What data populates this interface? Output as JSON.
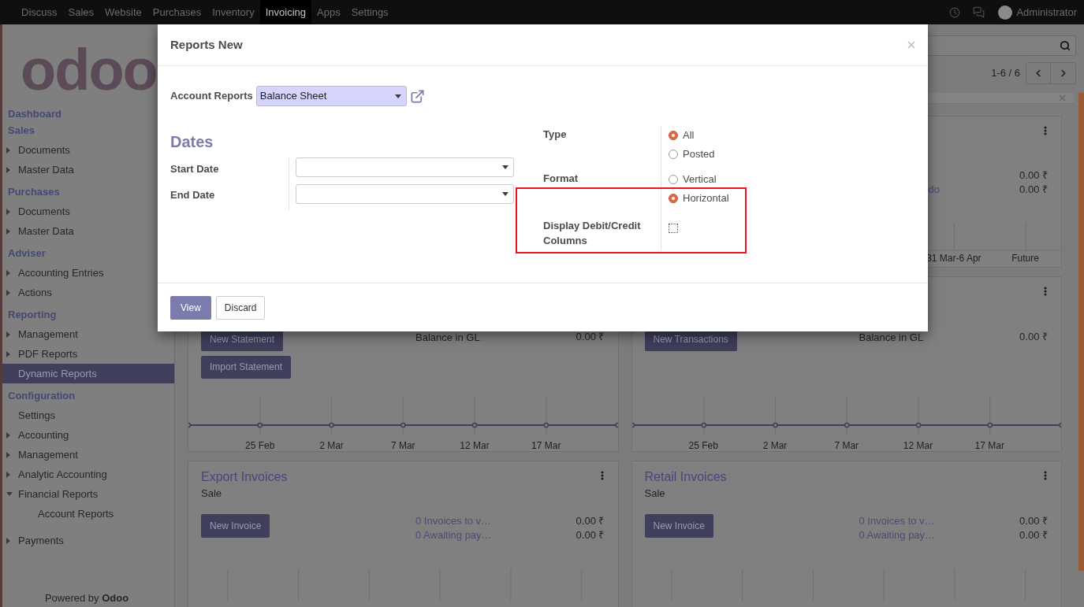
{
  "top_nav": {
    "apps": [
      {
        "label": "Discuss",
        "selected": false
      },
      {
        "label": "Sales",
        "selected": false
      },
      {
        "label": "Website",
        "selected": false
      },
      {
        "label": "Purchases",
        "selected": false
      },
      {
        "label": "Inventory",
        "selected": false
      },
      {
        "label": "Invoicing",
        "selected": true
      },
      {
        "label": "Apps",
        "selected": false
      },
      {
        "label": "Settings",
        "selected": false
      }
    ],
    "user": "Administrator"
  },
  "sidebar": {
    "logo": "odoo",
    "sections": [
      {
        "title": "Dashboard"
      },
      {
        "title": "Sales",
        "items": [
          {
            "label": "Documents",
            "expandable": true,
            "expanded": false,
            "selected": false
          },
          {
            "label": "Master Data",
            "expandable": true,
            "expanded": false,
            "selected": false
          }
        ]
      },
      {
        "title": "Purchases",
        "items": [
          {
            "label": "Documents",
            "expandable": true,
            "expanded": false,
            "selected": false
          },
          {
            "label": "Master Data",
            "expandable": true,
            "expanded": false,
            "selected": false
          }
        ]
      },
      {
        "title": "Adviser",
        "items": [
          {
            "label": "Accounting Entries",
            "expandable": true,
            "expanded": false,
            "selected": false
          },
          {
            "label": "Actions",
            "expandable": true,
            "expanded": false,
            "selected": false
          }
        ]
      },
      {
        "title": "Reporting",
        "items": [
          {
            "label": "Management",
            "expandable": true,
            "expanded": false,
            "selected": false
          },
          {
            "label": "PDF Reports",
            "expandable": true,
            "expanded": false,
            "selected": false
          },
          {
            "label": "Dynamic Reports",
            "expandable": false,
            "expanded": false,
            "selected": true
          }
        ]
      },
      {
        "title": "Configuration",
        "items": [
          {
            "label": "Settings",
            "expandable": false,
            "expanded": false,
            "selected": false
          },
          {
            "label": "Accounting",
            "expandable": true,
            "expanded": false,
            "selected": false
          },
          {
            "label": "Management",
            "expandable": true,
            "expanded": false,
            "selected": false
          },
          {
            "label": "Analytic Accounting",
            "expandable": true,
            "expanded": false,
            "selected": false
          },
          {
            "label": "Financial Reports",
            "expandable": true,
            "expanded": true,
            "selected": false,
            "children": [
              {
                "label": "Account Reports",
                "expandable": false,
                "expanded": false,
                "selected": false
              }
            ]
          },
          {
            "label": "Payments",
            "expandable": true,
            "expanded": false,
            "selected": false
          }
        ]
      }
    ],
    "footer": "Powered by **Odoo**"
  },
  "control_panel": {
    "pager": "1-6 / 6"
  },
  "dashboard": {
    "cards": [
      {
        "kind": "summary",
        "menu": true,
        "rows": [
          {
            "value": "0.00 ₹"
          },
          {
            "link": "do",
            "value": "0.00 ₹"
          }
        ],
        "chart_labels": [
          "31 Mar-6 Apr",
          "Future"
        ]
      },
      {
        "kind": "bank",
        "menu": false,
        "buttons": [
          "New Statement",
          "Import Statement"
        ],
        "balance_label": "Balance in GL",
        "balance_value": "0.00 ₹",
        "axis_labels": [
          "25 Feb",
          "2 Mar",
          "7 Mar",
          "12 Mar",
          "17 Mar"
        ]
      },
      {
        "kind": "bank",
        "menu": true,
        "buttons": [
          "New Transactions"
        ],
        "balance_label": "Balance in GL",
        "balance_value": "0.00 ₹",
        "axis_labels": [
          "25 Feb",
          "2 Mar",
          "7 Mar",
          "12 Mar",
          "17 Mar"
        ]
      },
      {
        "kind": "sale",
        "menu": true,
        "title": "Export Invoices",
        "subtitle": "Sale",
        "button": "New Invoice",
        "rows": [
          {
            "link": "0 Invoices to v…",
            "value": "0.00 ₹"
          },
          {
            "link": "0 Awaiting pay…",
            "value": "0.00 ₹"
          }
        ]
      },
      {
        "kind": "sale",
        "menu": true,
        "title": "Retail Invoices",
        "subtitle": "Sale",
        "button": "New Invoice",
        "rows": [
          {
            "link": "0 Invoices to v…",
            "value": "0.00 ₹"
          },
          {
            "link": "0 Awaiting pay…",
            "value": "0.00 ₹"
          }
        ]
      }
    ]
  },
  "dialog": {
    "title": "Reports New",
    "account_reports": {
      "label": "Account Reports",
      "value": "Balance Sheet"
    },
    "dates": {
      "heading": "Dates",
      "fields": [
        {
          "label": "Start Date"
        },
        {
          "label": "End Date"
        }
      ]
    },
    "type": {
      "label": "Type",
      "options": [
        {
          "label": "All",
          "selected": true
        },
        {
          "label": "Posted",
          "selected": false
        }
      ]
    },
    "format": {
      "label": "Format",
      "options": [
        {
          "label": "Vertical",
          "selected": false
        },
        {
          "label": "Horizontal",
          "selected": true
        }
      ]
    },
    "debit_credit": {
      "label": "Display Debit/Credit Columns",
      "checked": false
    },
    "buttons": [
      {
        "label": "View",
        "kind": "primary"
      },
      {
        "label": "Discard",
        "kind": "secondary"
      }
    ]
  }
}
